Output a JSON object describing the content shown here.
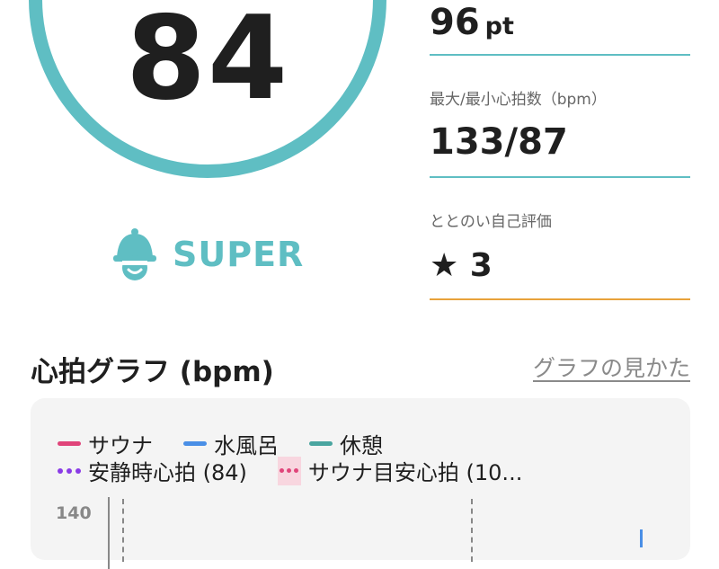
{
  "score": {
    "value": "84",
    "rank_label": "SUPER"
  },
  "stats": {
    "points": {
      "value": "96",
      "unit": "pt"
    },
    "heart_rate": {
      "label": "最大/最小心拍数（bpm）",
      "value": "133/87"
    },
    "self_eval": {
      "label": "ととのい自己評価",
      "value": "★ 3"
    }
  },
  "graph": {
    "title": "心拍グラフ (bpm)",
    "help_link": "グラフの見かた",
    "legend": [
      {
        "label": "サウナ",
        "color": "#e0457a",
        "style": "line"
      },
      {
        "label": "水風呂",
        "color": "#4a8fe6",
        "style": "line"
      },
      {
        "label": "休憩",
        "color": "#4aa5a0",
        "style": "line"
      },
      {
        "label": "安静時心拍 (84)",
        "color": "#8a3be6",
        "style": "dots"
      },
      {
        "label": "サウナ目安心拍 (10...",
        "color": "#e0457a",
        "style": "band"
      }
    ],
    "y_tick": "140"
  },
  "colors": {
    "accent": "#5fbec3",
    "eval_rule": "#e8a23a"
  }
}
